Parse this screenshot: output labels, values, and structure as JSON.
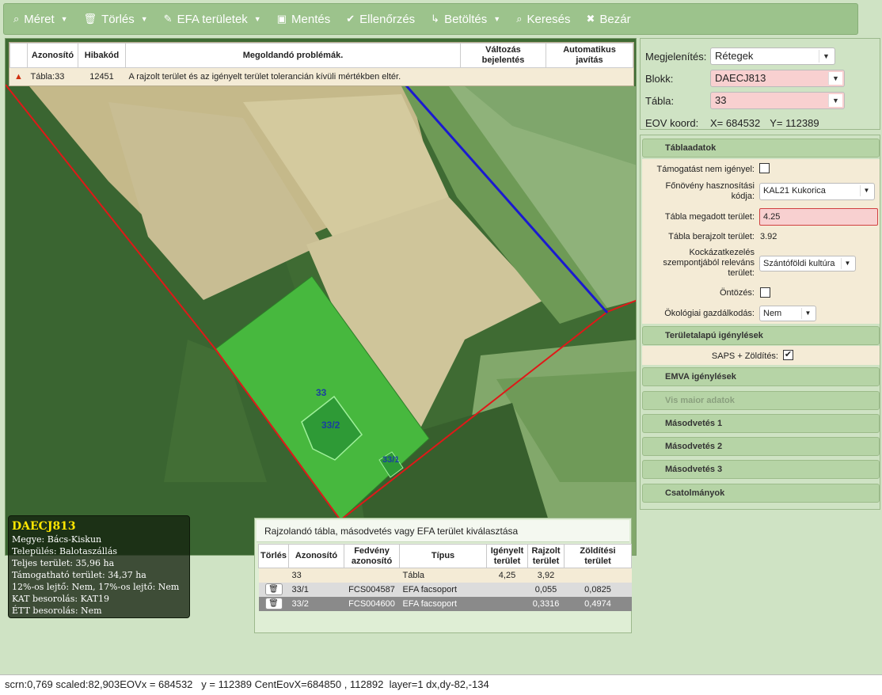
{
  "toolbar": {
    "items": [
      {
        "label": "Méret",
        "icon": "search-icon",
        "glyph": "⌕",
        "caret": true
      },
      {
        "label": "Törlés",
        "icon": "trash-icon",
        "glyph": "🗑",
        "caret": true
      },
      {
        "label": "EFA területek",
        "icon": "pencil-icon",
        "glyph": "✎",
        "caret": true
      },
      {
        "label": "Mentés",
        "icon": "save-icon",
        "glyph": "▣",
        "caret": false
      },
      {
        "label": "Ellenőrzés",
        "icon": "check-icon",
        "glyph": "✔",
        "caret": false
      },
      {
        "label": "Betöltés",
        "icon": "load-icon",
        "glyph": "↳",
        "caret": true
      },
      {
        "label": "Keresés",
        "icon": "search-icon",
        "glyph": "⌕",
        "caret": false
      },
      {
        "label": "Bezár",
        "icon": "close-icon",
        "glyph": "✖",
        "caret": false
      }
    ]
  },
  "errors": {
    "headers": {
      "id": "Azonosító",
      "code": "Hibakód",
      "problem": "Megoldandó problémák.",
      "change": "Változás bejelentés",
      "autofix": "Automatikus javítás"
    },
    "row": {
      "id": "Tábla:33",
      "code": "12451",
      "problem": "A rajzolt terület és az igényelt terület tolerancián kívüli mértékben eltér."
    }
  },
  "map": {
    "label_main": "33",
    "label_sub1": "33/2",
    "label_sub2": "33/1"
  },
  "infobox": {
    "title": "DAECJ813",
    "lines": [
      "Megye: Bács-Kiskun",
      "Település: Balotaszállás",
      "Teljes terület: 35,96 ha",
      "Támogatható terület: 34,37 ha",
      "12%-os lejtő: Nem, 17%-os lejtő: Nem",
      "KAT besorolás: KAT19",
      "ÉTT besorolás: Nem"
    ]
  },
  "selection": {
    "title": "Rajzolandó tábla, másodvetés vagy EFA terület kiválasztása",
    "headers": [
      "Törlés",
      "Azonosító",
      "Fedvény azonosító",
      "Típus",
      "Igényelt terület",
      "Rajzolt terület",
      "Zöldítési terület"
    ],
    "rows": [
      {
        "id": "33",
        "layer": "",
        "type": "Tábla",
        "claimed": "4,25",
        "drawn": "3,92",
        "green": ""
      },
      {
        "id": "33/1",
        "layer": "FCS004587",
        "type": "EFA facsoport",
        "claimed": "",
        "drawn": "0,055",
        "green": "0,0825"
      },
      {
        "id": "33/2",
        "layer": "FCS004600",
        "type": "EFA facsoport",
        "claimed": "",
        "drawn": "0,3316",
        "green": "0,4974"
      }
    ]
  },
  "right": {
    "display_label": "Megjelenítés:",
    "display_value": "Rétegek",
    "block_label": "Blokk:",
    "block_value": "DAECJ813",
    "table_label": "Tábla:",
    "table_value": "33",
    "eov_label": "EOV koord:",
    "eov_x": "X= 684532",
    "eov_y": "Y= 112389"
  },
  "accordion": {
    "tabla_header": "Táblaadatok",
    "no_support_label": "Támogatást nem igényel:",
    "crop_label": "Főnövény hasznosítási kódja:",
    "crop_value": "KAL21 Kukorica",
    "given_area_label": "Tábla megadott terület:",
    "given_area_value": "4.25",
    "drawn_area_label": "Tábla berajzolt terület:",
    "drawn_area_value": "3.92",
    "risk_label": "Kockázatkezelés szempontjából releváns terület:",
    "risk_value": "Szántóföldi kultúra",
    "irrigation_label": "Öntözés:",
    "eco_label": "Ökológiai gazdálkodás:",
    "eco_value": "Nem",
    "area_based_header": "Területalapú igénylések",
    "saps_label": "SAPS + Zöldítés:",
    "emva_header": "EMVA igénylések",
    "vis_maior_header": "Vis maior adatok",
    "second1_header": "Másodvetés 1",
    "second2_header": "Másodvetés 2",
    "second3_header": "Másodvetés 3",
    "attachments_header": "Csatolmányok"
  },
  "status": {
    "text": "scrn:0,769 scaled:82,903EOVx = 684532   y = 112389 CentEovX=684850 , 112892  layer=1 dx,dy-82,-134"
  }
}
